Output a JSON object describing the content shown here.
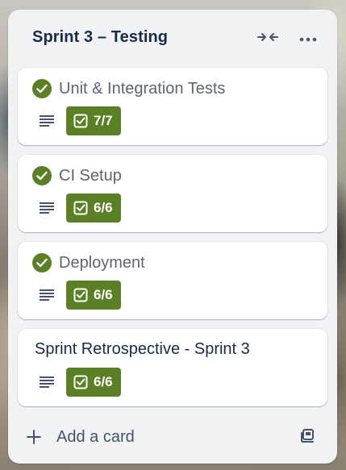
{
  "list": {
    "title": "Sprint 3 – Testing",
    "header_icons": [
      "collapse-icon",
      "more-icon"
    ],
    "cards": [
      {
        "title": "Unit & Integration Tests",
        "completed": true,
        "has_description": true,
        "checklist": "7/7"
      },
      {
        "title": "CI Setup",
        "completed": true,
        "has_description": true,
        "checklist": "6/6"
      },
      {
        "title": "Deployment",
        "completed": true,
        "has_description": true,
        "checklist": "6/6"
      },
      {
        "title": "Sprint Retrospective - Sprint 3",
        "completed": false,
        "has_description": true,
        "checklist": "6/6"
      }
    ],
    "footer": {
      "add_card_label": "Add a card",
      "template_icon": "card-template-icon"
    }
  },
  "colors": {
    "list_background": "#f1f2f4",
    "complete_green": "#5b7f24",
    "title_text": "#172b4d",
    "muted_text": "#5e6472"
  }
}
